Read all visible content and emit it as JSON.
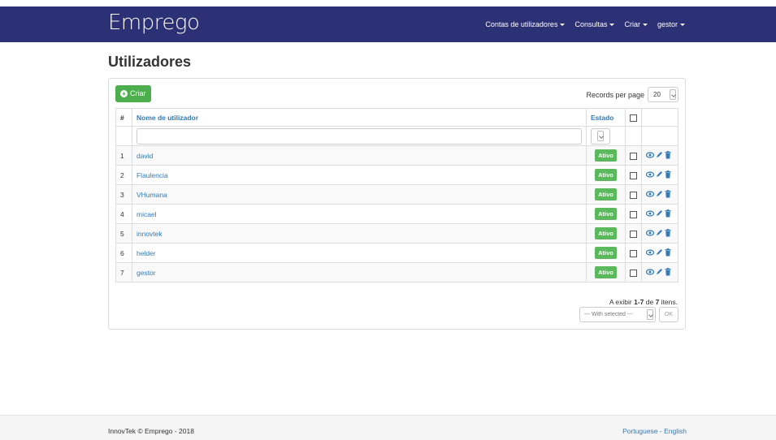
{
  "navbar": {
    "brand": "Emprego",
    "menu": [
      {
        "label": "Contas de utilizadores"
      },
      {
        "label": "Consultas"
      },
      {
        "label": "Criar"
      },
      {
        "label": "gestor"
      }
    ],
    "bg_color": "#2c3074"
  },
  "page": {
    "title": "Utilizadores"
  },
  "toolbar": {
    "create_label": "Criar",
    "rpp_label": "Records per page",
    "rpp_value": "20"
  },
  "table": {
    "headers": {
      "num": "#",
      "username": "Nome de utilizador",
      "status": "Estado"
    },
    "rows": [
      {
        "n": "1",
        "name": "david",
        "status": "Ativo"
      },
      {
        "n": "2",
        "name": "Flaulencia",
        "status": "Ativo"
      },
      {
        "n": "3",
        "name": "VHumana",
        "status": "Ativo"
      },
      {
        "n": "4",
        "name": "micael",
        "status": "Ativo"
      },
      {
        "n": "5",
        "name": "innovtek",
        "status": "Ativo"
      },
      {
        "n": "6",
        "name": "helder",
        "status": "Ativo"
      },
      {
        "n": "7",
        "name": "gestor",
        "status": "Ativo"
      }
    ]
  },
  "summary": {
    "prefix": "A exibir ",
    "range": "1-7",
    "mid": " de ",
    "total": "7",
    "suffix": " itens."
  },
  "bulk": {
    "placeholder": "--- With selected ---",
    "ok_label": "OK"
  },
  "footer": {
    "left": "InnovTek © Emprego - 2018",
    "lang_pt": "Portuguese",
    "sep": " - ",
    "lang_en": "English"
  },
  "colors": {
    "accent": "#337ab7",
    "success": "#5cb85c"
  }
}
